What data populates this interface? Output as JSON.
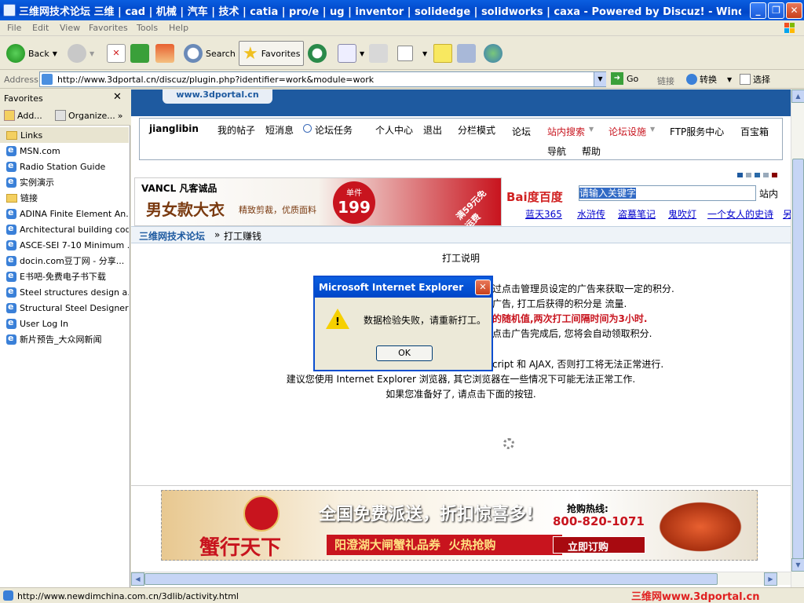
{
  "window": {
    "title": "三维网技术论坛 三维 | cad | 机械 | 汽车 | 技术 | catia | pro/e | ug | inventor | solidedge | solidworks | caxa - Powered by Discuz! - Windows Internet ...",
    "min": "_",
    "max": "❐",
    "close": "✕"
  },
  "menu": [
    "File",
    "Edit",
    "View",
    "Favorites",
    "Tools",
    "Help"
  ],
  "toolbar": {
    "back": "Back",
    "search": "Search",
    "favorites": "Favorites"
  },
  "address": {
    "label": "Address",
    "url": "http://www.3dportal.cn/discuz/plugin.php?identifier=work&module=work",
    "go": "Go",
    "links": "链接",
    "convert": "转换",
    "select": "选择"
  },
  "favorites_pane": {
    "title": "Favorites",
    "add": "Add...",
    "organize": "Organize...",
    "items": [
      {
        "label": "Links",
        "type": "folder"
      },
      {
        "label": "MSN.com",
        "type": "ie"
      },
      {
        "label": "Radio Station Guide",
        "type": "ie"
      },
      {
        "label": "实例演示",
        "type": "ie"
      },
      {
        "label": "链接",
        "type": "folder"
      },
      {
        "label": "ADINA Finite Element An...",
        "type": "ie"
      },
      {
        "label": "Architectural building cod...",
        "type": "ie"
      },
      {
        "label": "ASCE-SEI 7-10 Minimum ...",
        "type": "ie"
      },
      {
        "label": "docin.com豆丁网 - 分享...",
        "type": "ie"
      },
      {
        "label": "E书吧-免费电子书下载",
        "type": "ie"
      },
      {
        "label": "Steel structures design a...",
        "type": "ie"
      },
      {
        "label": "Structural Steel Designer'...",
        "type": "ie"
      },
      {
        "label": "User Log In",
        "type": "ie"
      },
      {
        "label": "新片预告_大众网新闻",
        "type": "ie"
      }
    ]
  },
  "page": {
    "logo_text": "www.3dportal.cn",
    "nav": {
      "user": "jianglibin",
      "my_posts": "我的帖子",
      "messages": "短消息",
      "tasks": "论坛任务",
      "profile": "个人中心",
      "logout": "退出",
      "split_mode": "分栏模式",
      "forum": "论坛",
      "site_search": "站内搜索",
      "facilities": "论坛设施",
      "ftp": "FTP服务中心",
      "treasure": "百宝箱",
      "navigation": "导航",
      "help": "帮助"
    },
    "vancl": {
      "brand": "VANCL 凡客诚品",
      "headline": "男女款大衣",
      "sub": "精致剪裁，优质面料",
      "price_label": "单件",
      "price": "199",
      "promo": "满59元免运费"
    },
    "baidu": {
      "logo": "Bai度百度",
      "search_value": "请输入关键字",
      "button": "站内",
      "links": [
        "蓝天365",
        "水浒传",
        "盗墓笔记",
        "鬼吹灯",
        "一个女人的史诗",
        "另"
      ]
    },
    "breadcrumb": {
      "home": "三维网技术论坛",
      "sep": "»",
      "current": "打工赚钱"
    },
    "work": {
      "title": "打工说明",
      "line1": "过点击管理员设定的广告来获取一定的积分.",
      "line2": "广告, 打工后获得的积分是 流量.",
      "line3": "的随机值,两次打工间隔时间为3小时.",
      "line4": "点击广告完成后, 您将会自动领取积分.",
      "line5": "cript 和 AJAX, 否则打工将无法正常进行.",
      "line6": "建议您使用 Internet Explorer 浏览器, 其它浏览器在一些情况下可能无法正常工作.",
      "line7": "如果您准备好了, 请点击下面的按钮."
    },
    "crab_ad": {
      "headline": "全国免费派送，折扣惊喜多!",
      "hotline_label": "抢购热线:",
      "hotline": "800-820-1071",
      "brand": "蟹行天下",
      "sub": "阳澄湖大闸蟹礼品券",
      "hot": "火热抢购",
      "order": "立即订购"
    }
  },
  "status": {
    "url": "http://www.newdimchina.com.cn/3dlib/activity.html",
    "watermark": "三维网www.3dportal.cn"
  },
  "dialog": {
    "title": "Microsoft Internet Explorer",
    "message": "数据检验失败，请重新打工。",
    "ok": "OK"
  }
}
